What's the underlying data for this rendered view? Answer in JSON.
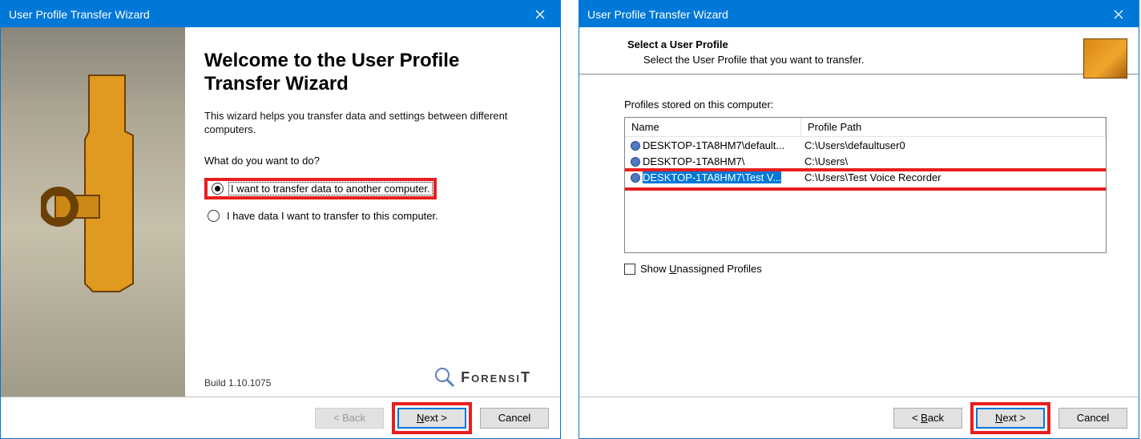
{
  "window1": {
    "title": "User Profile Transfer Wizard",
    "heading": "Welcome to the User Profile Transfer Wizard",
    "intro": "This wizard helps you transfer data and settings between different computers.",
    "question": "What do you want to do?",
    "option1": "I want to transfer data to another computer.",
    "option2": "I have data I want to transfer to this computer.",
    "build": "Build 1.10.1075",
    "brand": "ForensiT",
    "back": "< Back",
    "next_pre": "N",
    "next_post": "ext >",
    "cancel": "Cancel"
  },
  "window2": {
    "title": "User Profile Transfer Wizard",
    "hdr_title": "Select a User Profile",
    "hdr_sub": "Select the User Profile that you want to transfer.",
    "label": "Profiles stored on this computer:",
    "col_name": "Name",
    "col_path": "Profile Path",
    "rows": [
      {
        "name": "DESKTOP-1TA8HM7\\default...",
        "path": "C:\\Users\\defaultuser0"
      },
      {
        "name": "DESKTOP-1TA8HM7\\",
        "path": "C:\\Users\\"
      },
      {
        "name": "DESKTOP-1TA8HM7\\Test V...",
        "path": "C:\\Users\\Test Voice Recorder"
      }
    ],
    "show_pre": "Show ",
    "show_u": "U",
    "show_post": "nassigned Profiles",
    "back_pre": "< ",
    "back_u": "B",
    "back_post": "ack",
    "next_pre": "N",
    "next_post": "ext >",
    "cancel": "Cancel"
  }
}
